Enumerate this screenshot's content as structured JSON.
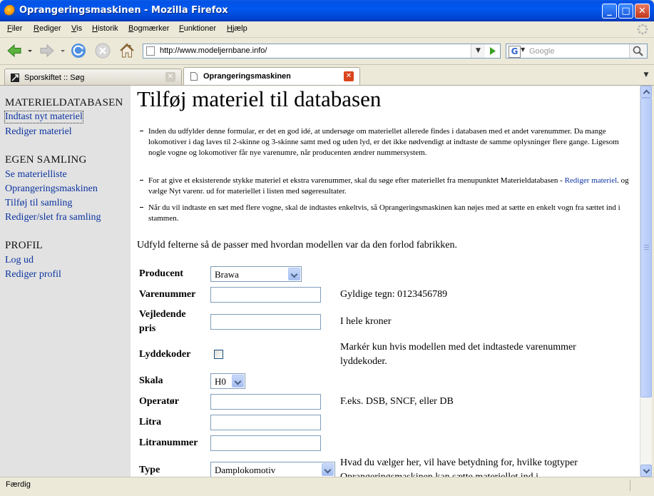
{
  "window": {
    "title": "Oprangeringsmaskinen - Mozilla Firefox"
  },
  "menu": [
    "Filer",
    "Rediger",
    "Vis",
    "Historik",
    "Bogmærker",
    "Funktioner",
    "Hjælp"
  ],
  "navbar": {
    "url": "http://www.modeljernbane.info/",
    "search_placeholder": "Google"
  },
  "tabs": [
    {
      "label": "Sporskiftet :: Søg",
      "active": false
    },
    {
      "label": "Oprangeringsmaskinen",
      "active": true
    }
  ],
  "sidebar": {
    "sections": [
      {
        "heading": "MATERIELDATABASEN",
        "links": [
          "Indtast nyt materiel",
          "Rediger materiel"
        ]
      },
      {
        "heading": "EGEN SAMLING",
        "links": [
          "Se materielliste",
          "Oprangeringsmaskinen",
          "Tilføj til samling",
          "Rediger/slet fra samling"
        ]
      },
      {
        "heading": "PROFIL",
        "links": [
          "Log ud",
          "Rediger profil"
        ]
      }
    ]
  },
  "main": {
    "title": "Tilføj materiel til databasen",
    "notes": {
      "n1": "Inden du udfylder denne formular, er det en god idé, at undersøge om materiellet allerede findes i databasen med et andet varenummer. Da mange lokomotiver i dag laves til 2-skinne og 3-skinne samt med og uden lyd, er det ikke nødvendigt at indtaste de samme oplysninger flere gange. Ligesom nogle vogne og lokomotiver får nye varenumre, når producenten ændrer nummersystem.",
      "n2_before": "For at give et eksisterende stykke materiel et ekstra varenummer, skal du søge efter materiellet fra menupunktet Materieldatabasen - ",
      "n2_link": "Rediger materiel",
      "n2_after": ". og vælge Nyt varenr. ud for materiellet i listen med søgeresultater.",
      "n3": "Når du vil indtaste en sæt med flere vogne, skal de indtastes enkeltvis, så Oprangeringsmaskinen kan nøjes med at sætte en enkelt vogn fra sættet ind i stammen."
    },
    "intro": "Udfyld felterne så de passer med hvordan modellen var da den forlod fabrikken.",
    "form": {
      "producent": {
        "label": "Producent",
        "value": "Brawa"
      },
      "varenummer": {
        "label": "Varenummer",
        "hint": "Gyldige tegn: 0123456789"
      },
      "pris": {
        "label": "Vejledende pris",
        "hint": "I hele kroner"
      },
      "lyddekoder": {
        "label": "Lyddekoder",
        "hint": "Markér kun hvis modellen med det indtastede varenummer lyddekoder."
      },
      "skala": {
        "label": "Skala",
        "value": "H0"
      },
      "operator": {
        "label": "Operatør",
        "hint": "F.eks. DSB, SNCF, eller DB"
      },
      "litra": {
        "label": "Litra"
      },
      "litranummer": {
        "label": "Litranummer"
      },
      "type": {
        "label": "Type",
        "value": "Damplokomotiv",
        "hint": "Hvad du vælger her, vil have betydning for, hvilke togtyper Oprangeringsmaskinen kan sætte materiellet ind i."
      }
    }
  },
  "status": "Færdig"
}
